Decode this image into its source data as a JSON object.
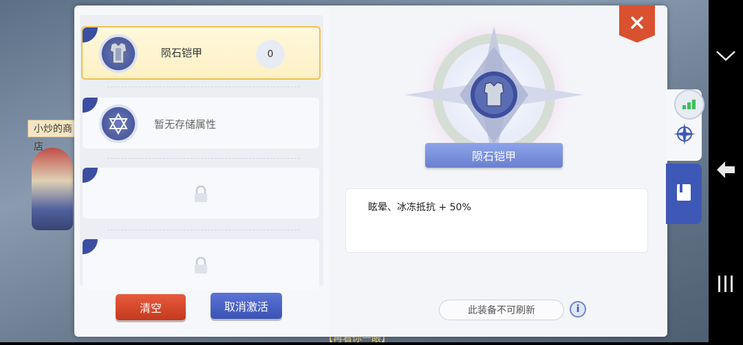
{
  "background": {
    "shop_sign": "小炒的商店",
    "bottom_text": "【再看你一眼】"
  },
  "left_panel": {
    "slots": [
      {
        "state": "active",
        "name": "陨石铠甲",
        "count": "0"
      },
      {
        "state": "empty",
        "text": "暂无存储属性"
      },
      {
        "state": "locked"
      },
      {
        "state": "locked"
      }
    ]
  },
  "buttons": {
    "clear": "清空",
    "cancel_activation": "取消激活"
  },
  "detail": {
    "item_name": "陨石铠甲",
    "attribute_text": "眩晕、冰冻抵抗 + 50%",
    "refresh_status": "此装备不可刷新",
    "info_label": "i"
  },
  "colors": {
    "accent_blue": "#3e58b8",
    "accent_red": "#d9512f",
    "active_border": "#f2c14b"
  },
  "icons": {
    "close": "close-icon",
    "armor": "armor-icon",
    "hexagram": "hexagram-icon",
    "lock": "lock-icon",
    "compass": "compass-icon",
    "book": "book-icon",
    "signal": "signal-icon",
    "chevron_down": "chevron-down-icon",
    "back": "back-icon",
    "recent_apps": "recent-apps-icon"
  }
}
